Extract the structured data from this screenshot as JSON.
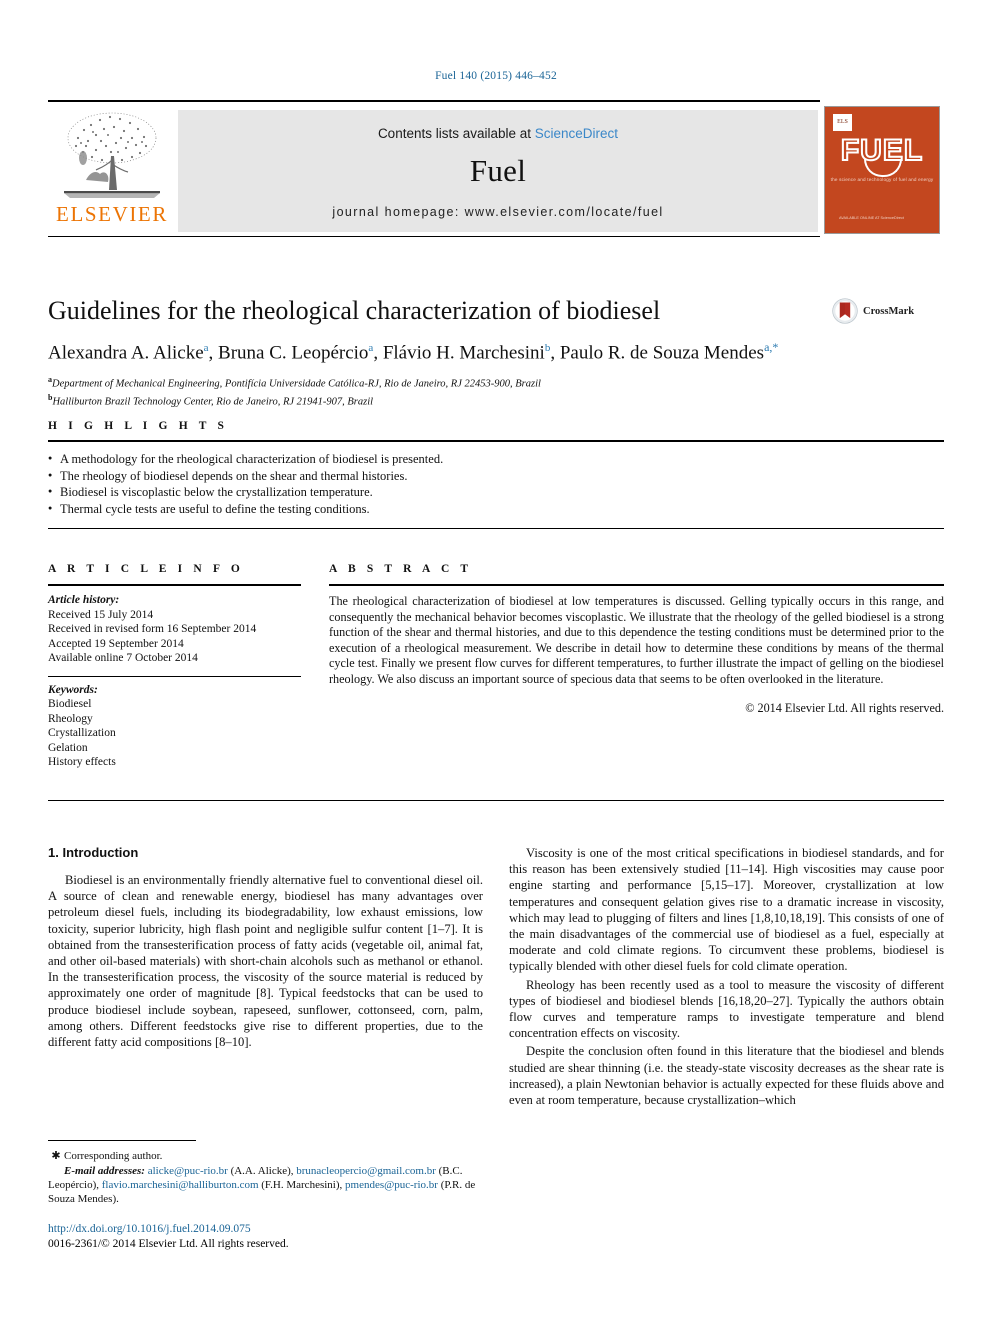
{
  "running_head": "Fuel 140 (2015) 446–452",
  "masthead": {
    "contents_prefix": "Contents lists available at ",
    "sciencedirect": "ScienceDirect",
    "journal_name": "Fuel",
    "homepage": "journal homepage: www.elsevier.com/locate/fuel",
    "publisher_wordmark": "ELSEVIER",
    "cover": {
      "title": "FUEL",
      "subtitle": "the science and technology of fuel and energy",
      "footer": "AVAILABLE ONLINE AT\nScienceDirect"
    }
  },
  "article": {
    "title": "Guidelines for the rheological characterization of biodiesel",
    "authors_html": "Alexandra A. Alicke <sup>a</sup>, Bruna C. Leopércio <sup>a</sup>, Flávio H. Marchesini <sup>b</sup>, Paulo R. de Souza Mendes <sup>a,*</sup>",
    "affiliations": [
      {
        "mark": "a",
        "text": "Department of Mechanical Engineering, Pontifícia Universidade Católica-RJ, Rio de Janeiro, RJ 22453-900, Brazil"
      },
      {
        "mark": "b",
        "text": "Halliburton Brazil Technology Center, Rio de Janeiro, RJ 21941-907, Brazil"
      }
    ],
    "crossmark_label": "CrossMark"
  },
  "highlights": {
    "heading": "H I G H L I G H T S",
    "items": [
      "A methodology for the rheological characterization of biodiesel is presented.",
      "The rheology of biodiesel depends on the shear and thermal histories.",
      "Biodiesel is viscoplastic below the crystallization temperature.",
      "Thermal cycle tests are useful to define the testing conditions."
    ]
  },
  "article_info": {
    "heading": "A R T I C L E    I N F O",
    "history_label": "Article history:",
    "history": [
      "Received 15 July 2014",
      "Received in revised form 16 September 2014",
      "Accepted 19 September 2014",
      "Available online 7 October 2014"
    ],
    "keywords_label": "Keywords:",
    "keywords": [
      "Biodiesel",
      "Rheology",
      "Crystallization",
      "Gelation",
      "History effects"
    ]
  },
  "abstract": {
    "heading": "A B S T R A C T",
    "text": "The rheological characterization of biodiesel at low temperatures is discussed. Gelling typically occurs in this range, and consequently the mechanical behavior becomes viscoplastic. We illustrate that the rheology of the gelled biodiesel is a strong function of the shear and thermal histories, and due to this dependence the testing conditions must be determined prior to the execution of a rheological measurement. We describe in detail how to determine these conditions by means of the thermal cycle test. Finally we present flow curves for different temperatures, to further illustrate the impact of gelling on the biodiesel rheology. We also discuss an important source of specious data that seems to be often overlooked in the literature.",
    "copyright": "© 2014 Elsevier Ltd. All rights reserved."
  },
  "body": {
    "section_title": "1. Introduction",
    "left_paragraphs": [
      "Biodiesel is an environmentally friendly alternative fuel to conventional diesel oil. A source of clean and renewable energy, biodiesel has many advantages over petroleum diesel fuels, including its biodegradability, low exhaust emissions, low toxicity, superior lubricity, high flash point and negligible sulfur content [1–7]. It is obtained from the transesterification process of fatty acids (vegetable oil, animal fat, and other oil-based materials) with short-chain alcohols such as methanol or ethanol. In the transesterification process, the viscosity of the source material is reduced by approximately one order of magnitude [8]. Typical feedstocks that can be used to produce biodiesel include soybean, rapeseed, sunflower, cottonseed, corn, palm, among others. Different feedstocks give rise to different properties, due to the different fatty acid compositions [8–10]."
    ],
    "right_paragraphs": [
      "Viscosity is one of the most critical specifications in biodiesel standards, and for this reason has been extensively studied [11–14]. High viscosities may cause poor engine starting and performance [5,15–17]. Moreover, crystallization at low temperatures and consequent gelation gives rise to a dramatic increase in viscosity, which may lead to plugging of filters and lines [1,8,10,18,19]. This consists of one of the main disadvantages of the commercial use of biodiesel as a fuel, especially at moderate and cold climate regions. To circumvent these problems, biodiesel is typically blended with other diesel fuels for cold climate operation.",
      "Rheology has been recently used as a tool to measure the viscosity of different types of biodiesel and biodiesel blends [16,18,20–27]. Typically the authors obtain flow curves and temperature ramps to investigate temperature and blend concentration effects on viscosity.",
      "Despite the conclusion often found in this literature that the biodiesel and blends studied are shear thinning (i.e. the steady-state viscosity decreases as the shear rate is increased), a plain Newtonian behavior is actually expected for these fluids above and even at room temperature, because crystallization–which"
    ]
  },
  "footnote": {
    "corresponding": "Corresponding author.",
    "email_label": "E-mail addresses:",
    "emails": [
      {
        "address": "alicke@puc-rio.br",
        "name": "(A.A. Alicke)"
      },
      {
        "address": "brunacleopercio@gmail.com.br",
        "name": "(B.C. Leopércio)"
      },
      {
        "address": "flavio.marchesini@halliburton.com",
        "name": "(F.H. Marchesini)"
      },
      {
        "address": "pmendes@puc-rio.br",
        "name": "(P.R. de Souza Mendes)"
      }
    ],
    "doi": "http://dx.doi.org/10.1016/j.fuel.2014.09.075",
    "issn_line": "0016-2361/© 2014 Elsevier Ltd. All rights reserved."
  },
  "colors": {
    "link": "#1a6496",
    "elsevier_orange": "#ec7404",
    "cover_red": "#c3471f",
    "masthead_gray": "#e6e6e6"
  }
}
